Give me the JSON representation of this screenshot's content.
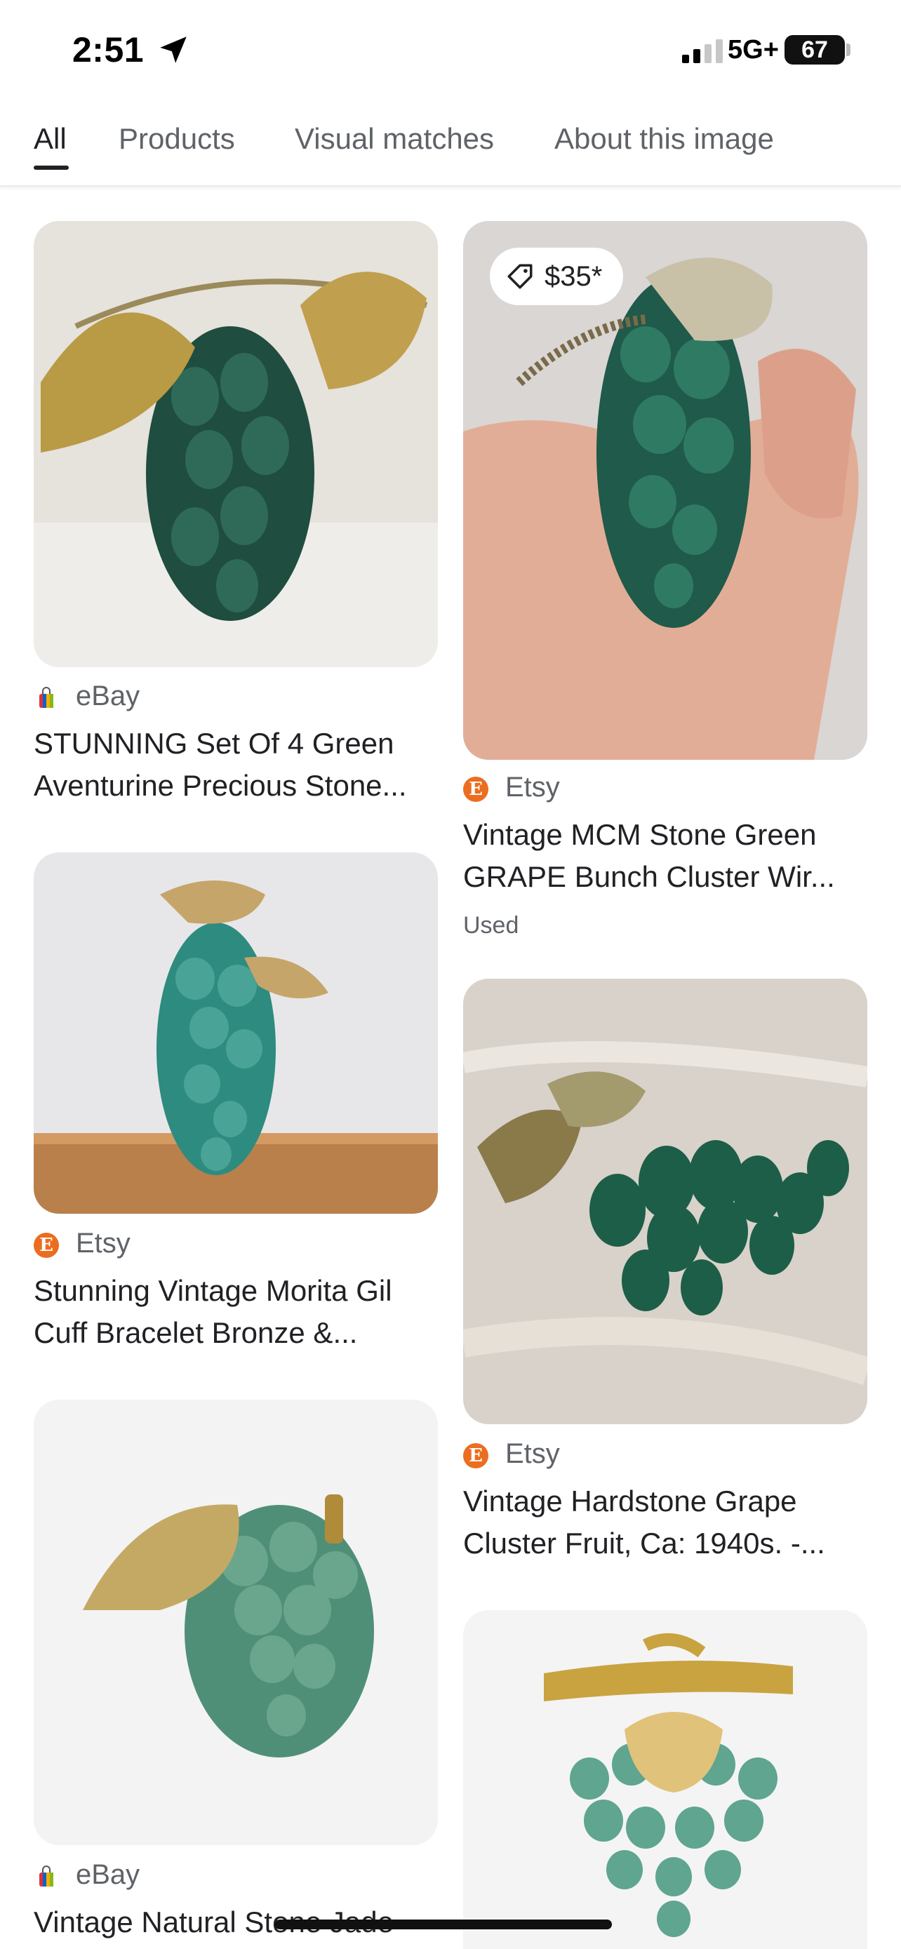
{
  "status_bar": {
    "time": "2:51",
    "network": "5G+",
    "battery": "67"
  },
  "tabs": [
    {
      "label": "All",
      "active": true
    },
    {
      "label": "Products",
      "active": false
    },
    {
      "label": "Visual matches",
      "active": false
    },
    {
      "label": "About this image",
      "active": false
    }
  ],
  "results": [
    {
      "source": "eBay",
      "source_icon": "ebay-bag-icon",
      "title_line1": "STUNNING Set Of 4 Green",
      "title_line2": "Aventurine Precious Stone..."
    },
    {
      "price": "$35*",
      "source": "Etsy",
      "source_icon": "etsy-icon",
      "title_line1": "Vintage MCM Stone Green",
      "title_line2": "GRAPE Bunch Cluster Wir...",
      "condition": "Used"
    },
    {
      "source": "Etsy",
      "source_icon": "etsy-icon",
      "title_line1": "Stunning Vintage Morita Gil",
      "title_line2": "Cuff Bracelet Bronze &..."
    },
    {
      "source": "Etsy",
      "source_icon": "etsy-icon",
      "title_line1": "Vintage Hardstone Grape",
      "title_line2": "Cluster Fruit, Ca: 1940s. -..."
    },
    {
      "source": "eBay",
      "source_icon": "ebay-bag-icon",
      "title_line1": "Vintage Natural Stone Jade",
      "title_line2": ""
    },
    {
      "source": "",
      "title_line1": "",
      "title_line2": ""
    }
  ],
  "etsy_letter": "E",
  "colors": {
    "etsy": "#eb6d20",
    "text_primary": "#202124",
    "text_secondary": "#5f6368"
  }
}
